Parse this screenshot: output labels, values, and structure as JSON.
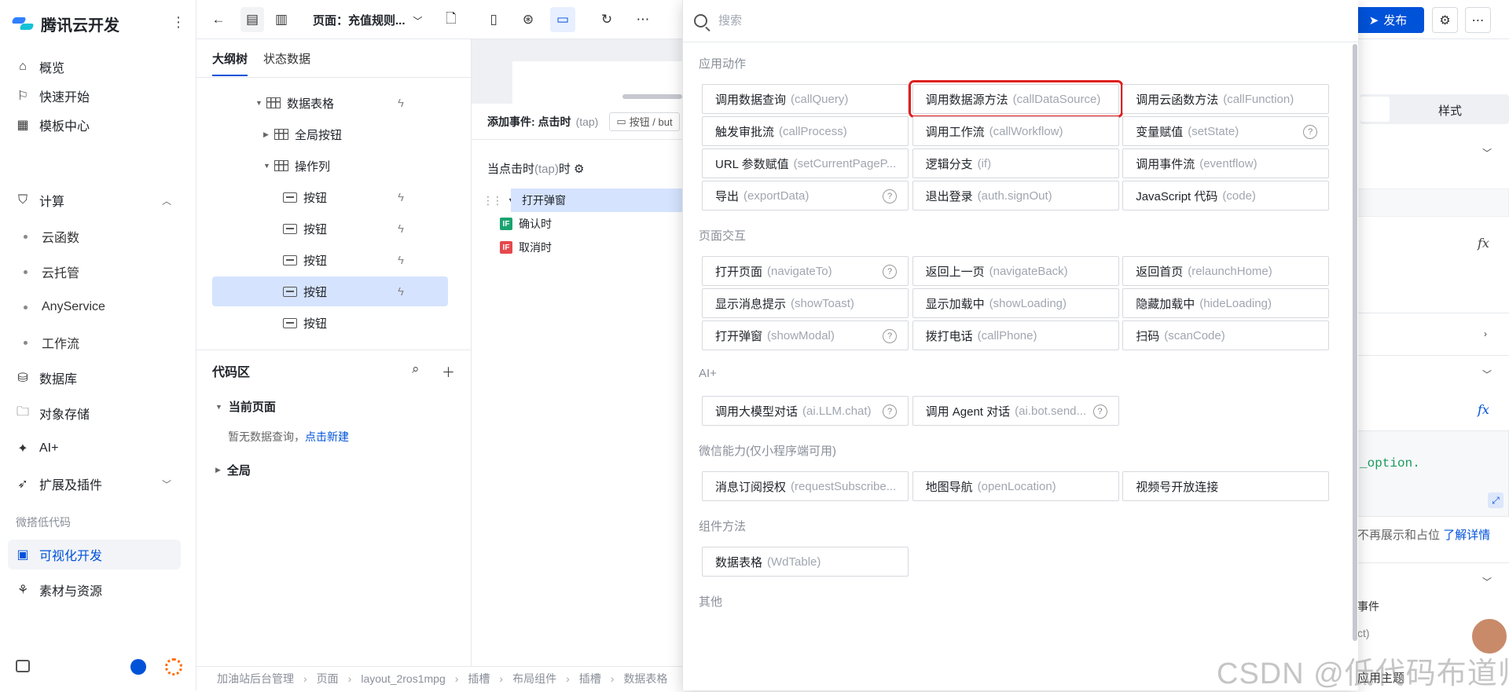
{
  "app": {
    "title": "腾讯云开发"
  },
  "nav": {
    "items": [
      {
        "label": "概览",
        "icon": "home-icon"
      },
      {
        "label": "快速开始",
        "icon": "flag-icon"
      },
      {
        "label": "模板中心",
        "icon": "grid-icon"
      },
      {
        "label": "计算",
        "icon": "shield-icon"
      },
      {
        "label": "数据库",
        "icon": "database-icon"
      },
      {
        "label": "对象存储",
        "icon": "folder-icon"
      },
      {
        "label": "AI+",
        "icon": "sparkle-icon"
      },
      {
        "label": "扩展及插件",
        "icon": "rocket-icon"
      },
      {
        "label": "可视化开发",
        "icon": "visual-dev-icon"
      },
      {
        "label": "素材与资源",
        "icon": "shapes-icon"
      }
    ],
    "sub_items": [
      "云函数",
      "云托管",
      "AnyService",
      "工作流"
    ],
    "group_label": "微搭低代码"
  },
  "toolbar": {
    "page_label": "页面：充值规则...",
    "publish_label": "发布"
  },
  "outline": {
    "tabs": [
      "大纲树",
      "状态数据"
    ],
    "tree": [
      {
        "label": "数据表格",
        "type": "table"
      },
      {
        "label": "全局按钮",
        "type": "table"
      },
      {
        "label": "操作列",
        "type": "table"
      },
      {
        "label": "按钮",
        "type": "button"
      },
      {
        "label": "按钮",
        "type": "button"
      },
      {
        "label": "按钮",
        "type": "button"
      },
      {
        "label": "按钮",
        "type": "button"
      },
      {
        "label": "按钮",
        "type": "button"
      }
    ],
    "code_area": {
      "title": "代码区",
      "current_page": "当前页面",
      "empty_tip": "暂无数据查询，",
      "create_link": "点击新建",
      "global": "全局"
    }
  },
  "event": {
    "title": "添加事件: 点击时",
    "title_sub": "(tap)",
    "chip": "按钮 / but",
    "when": "当点击时",
    "when_sub": "(tap)",
    "when_suffix": "时",
    "flow": [
      {
        "label": "打开弹窗"
      },
      {
        "label": "确认时",
        "badge": "IF",
        "badge_color": "#1aa36f"
      },
      {
        "label": "取消时",
        "badge": "IF",
        "badge_color": "#e5484d"
      }
    ]
  },
  "breadcrumb": [
    "加油站后台管理",
    "页面",
    "layout_2ros1mpg",
    "插槽",
    "布局组件",
    "插槽",
    "数据表格"
  ],
  "picker": {
    "search_placeholder": "搜索",
    "sections": [
      {
        "title": "应用动作",
        "actions": [
          {
            "label": "调用数据查询",
            "code": "(callQuery)"
          },
          {
            "label": "调用数据源方法",
            "code": "(callDataSource)",
            "highlight": true
          },
          {
            "label": "调用云函数方法",
            "code": "(callFunction)"
          },
          {
            "label": "触发审批流",
            "code": "(callProcess)"
          },
          {
            "label": "调用工作流",
            "code": "(callWorkflow)"
          },
          {
            "label": "变量赋值",
            "code": "(setState)",
            "help": true
          },
          {
            "label": "URL 参数赋值",
            "code": "(setCurrentPageP..."
          },
          {
            "label": "逻辑分支",
            "code": "(if)"
          },
          {
            "label": "调用事件流",
            "code": "(eventflow)"
          },
          {
            "label": "导出",
            "code": "(exportData)",
            "help": true
          },
          {
            "label": "退出登录",
            "code": "(auth.signOut)"
          },
          {
            "label": "JavaScript 代码",
            "code": "(code)"
          }
        ]
      },
      {
        "title": "页面交互",
        "actions": [
          {
            "label": "打开页面",
            "code": "(navigateTo)",
            "help": true
          },
          {
            "label": "返回上一页",
            "code": "(navigateBack)"
          },
          {
            "label": "返回首页",
            "code": "(relaunchHome)"
          },
          {
            "label": "显示消息提示",
            "code": "(showToast)"
          },
          {
            "label": "显示加载中",
            "code": "(showLoading)"
          },
          {
            "label": "隐藏加载中",
            "code": "(hideLoading)"
          },
          {
            "label": "打开弹窗",
            "code": "(showModal)",
            "help": true
          },
          {
            "label": "拨打电话",
            "code": "(callPhone)"
          },
          {
            "label": "扫码",
            "code": "(scanCode)"
          }
        ]
      },
      {
        "title": "AI+",
        "actions": [
          {
            "label": "调用大模型对话",
            "code": "(ai.LLM.chat)",
            "help": true
          },
          {
            "label": "调用 Agent 对话",
            "code": "(ai.bot.send...",
            "help": true
          }
        ]
      },
      {
        "title": "微信能力(仅小程序端可用)",
        "actions": [
          {
            "label": "消息订阅授权",
            "code": "(requestSubscribe..."
          },
          {
            "label": "地图导航",
            "code": "(openLocation)"
          },
          {
            "label": "视频号开放连接",
            "code": ""
          }
        ]
      },
      {
        "title": "组件方法",
        "actions": [
          {
            "label": "数据表格",
            "code": "(WdTable)"
          }
        ]
      },
      {
        "title": "其他",
        "actions": []
      }
    ]
  },
  "props": {
    "style_tab": "样式",
    "code_snippet": "_option.",
    "note_text": "不再展示和占位",
    "note_link": "了解详情",
    "event_label": "事件",
    "ct_text": "ct)",
    "theme_label": "应用主题"
  },
  "watermark": "CSDN @低代码布道师"
}
